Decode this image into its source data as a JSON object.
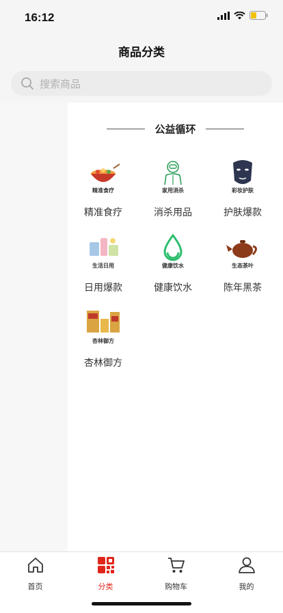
{
  "status": {
    "time": "16:12"
  },
  "header": {
    "title": "商品分类"
  },
  "search": {
    "placeholder": "搜索商品",
    "icon": "search-icon"
  },
  "section": {
    "title": "公益循环"
  },
  "categories": [
    {
      "label": "精准食疗",
      "thumb_text": "精准食疗",
      "icon": "hotpot-bowl-icon"
    },
    {
      "label": "消杀用品",
      "thumb_text": "家用消杀",
      "icon": "hazmat-person-icon"
    },
    {
      "label": "护肤爆款",
      "thumb_text": "彩妆护肤",
      "icon": "face-mask-icon"
    },
    {
      "label": "日用爆款",
      "thumb_text": "生活日用",
      "icon": "household-items-icon"
    },
    {
      "label": "健康饮水",
      "thumb_text": "健康饮水",
      "icon": "water-drop-icon"
    },
    {
      "label": "陈年黑茶",
      "thumb_text": "生态茶叶",
      "icon": "teapot-icon"
    },
    {
      "label": "杏林御方",
      "thumb_text": "杏林御方",
      "icon": "medicine-box-icon"
    }
  ],
  "tabs": [
    {
      "label": "首页",
      "icon": "home-icon",
      "active": false
    },
    {
      "label": "分类",
      "icon": "category-grid-icon",
      "active": true
    },
    {
      "label": "购物车",
      "icon": "cart-icon",
      "active": false
    },
    {
      "label": "我的",
      "icon": "user-icon",
      "active": false
    }
  ],
  "colors": {
    "accent": "#e1251b",
    "background": "#f5f5f5",
    "water_green": "#2dbd6e",
    "tea_brown": "#8b3a1a"
  }
}
